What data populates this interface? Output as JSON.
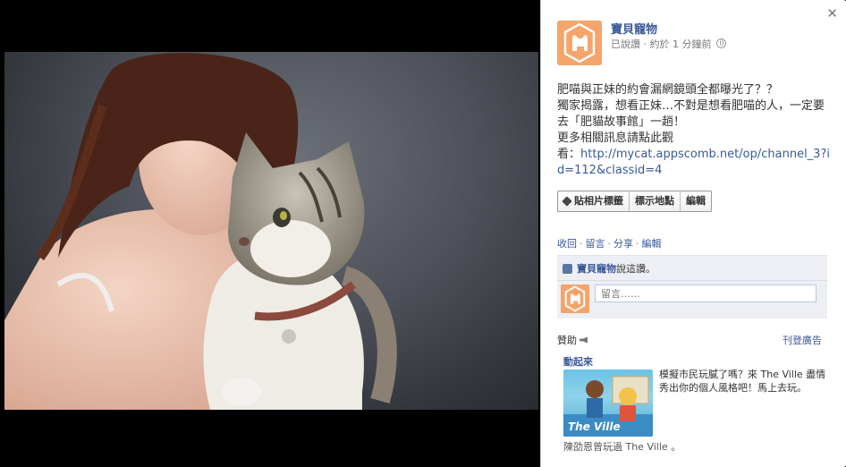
{
  "post": {
    "page_name": "寶貝寵物",
    "meta_text": "已說讚 · 約於 1 分鐘前",
    "caption_lines": [
      "肥喵與正妹的約會漏網鏡頭全都曝光了？？",
      "獨家揭露，想看正妹…不對是想看肥喵的人，一定要去「肥貓故事館」一趟！",
      "更多相關訊息請點此觀",
      "看："
    ],
    "link_text": "http://mycat.appscomb.net/op/channel_3?id=112&classid=4"
  },
  "photo_actions": {
    "tag": "貼相片標籤",
    "location": "標示地點",
    "edit": "編輯"
  },
  "post_actions": [
    "收回",
    "留言",
    "分享",
    "編輯"
  ],
  "likes": {
    "name": "寶貝寵物",
    "suffix": "說這讚。"
  },
  "comment": {
    "placeholder": "留言……"
  },
  "sponsored": {
    "label": "贊助",
    "create_ad": "刊登廣告",
    "ad_title": "動起來",
    "ad_text": "模擬市民玩膩了嗎？來 The Ville 盡情秀出你的個人風格吧！馬上去玩。",
    "ad_image_text": "The Ville",
    "ad_social": "陳劭恩曾玩過 The Ville 。"
  },
  "colors": {
    "link": "#3b5998",
    "avatar_bg": "#f5a46a",
    "like_box_bg": "#edeff4"
  }
}
